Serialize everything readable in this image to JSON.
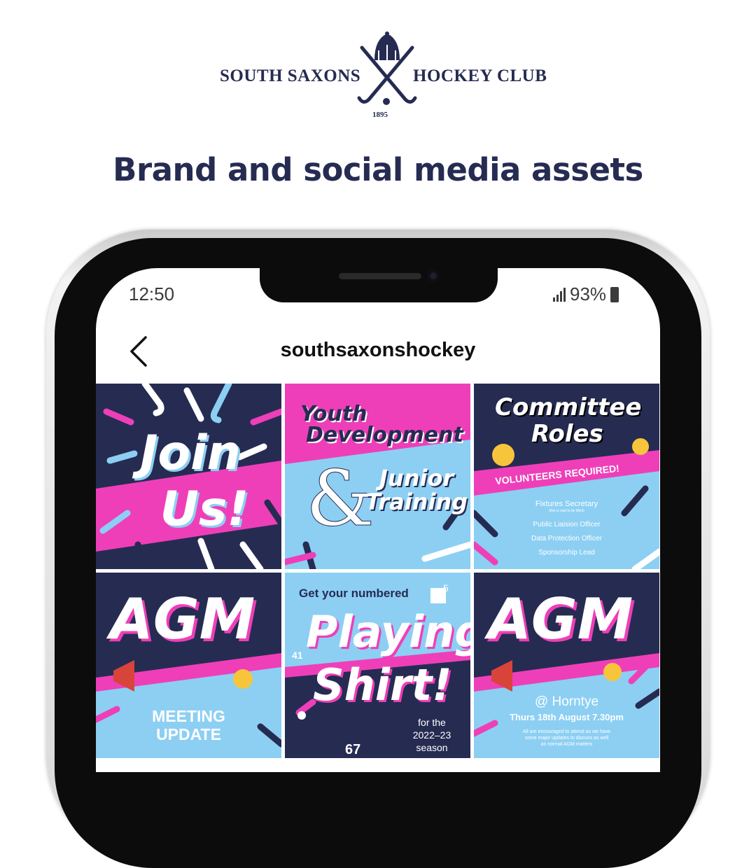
{
  "brand": {
    "name_left": "SOUTH SAXONS",
    "name_right": "HOCKEY CLUB",
    "year": "1895",
    "colors": {
      "navy": "#262b52",
      "pink": "#ee3fb9",
      "light_blue": "#8ccff3"
    }
  },
  "headline": "Brand and social media assets",
  "phone": {
    "status": {
      "time": "12:50",
      "battery": "93%"
    },
    "profile": {
      "username": "southsaxonshockey",
      "back_icon": "chevron-left-icon"
    }
  },
  "posts": [
    {
      "title": "Join Us!",
      "line1": "Join",
      "line2": "Us!"
    },
    {
      "title": "Youth Development & Junior Training",
      "line1": "Youth",
      "line2": "Development",
      "amp": "&",
      "line3": "Junior",
      "line4": "Training"
    },
    {
      "title": "Committee Roles",
      "line1": "Committee",
      "line2": "Roles",
      "banner": "VOLUNTEERS REQUIRED!",
      "roles": [
        "Fixtures Secretary",
        "(this is vital to be filled)",
        "Public Liaision Officer",
        "Data Protection Officer",
        "Sponsorship Lead"
      ]
    },
    {
      "title": "AGM",
      "subtitle_1": "MEETING",
      "subtitle_2": "UPDATE"
    },
    {
      "title": "Playing Shirt!",
      "intro": "Get your numbered",
      "line1": "Playing",
      "line2": "Shirt!",
      "footer_1": "for the",
      "footer_2": "2022–23",
      "footer_3": "season",
      "num_a": "41",
      "num_b": "5",
      "num_c": "67"
    },
    {
      "title": "AGM",
      "venue": "@ Horntye",
      "date": "Thurs 18th August 7.30pm",
      "note_1": "All are encouraged to attend as we have",
      "note_2": "some major updates to discuss as well",
      "note_3": "as normal AGM matters"
    }
  ]
}
